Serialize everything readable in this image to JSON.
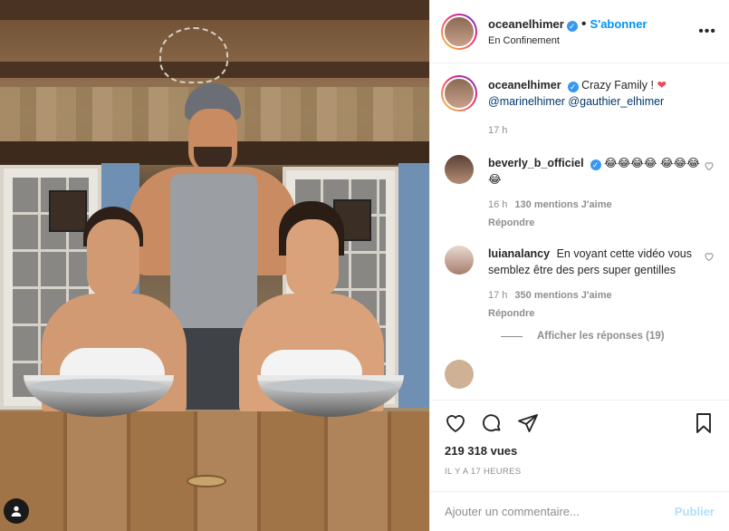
{
  "post": {
    "username": "oceanelhimer",
    "location": "En Confinement",
    "follow_label": "S'abonner",
    "dot": "•",
    "more_icon": "more-horizontal-icon",
    "caption_text": "Crazy Family !",
    "caption_emoji": "❤",
    "caption_mentions": [
      "@marinelhimer",
      "@gauthier_elhimer"
    ],
    "caption_time": "17 h",
    "views": "219 318 vues",
    "posted_ago": "IL Y A 17 HEURES"
  },
  "comments": [
    {
      "username": "beverly_b_officiel",
      "verified": true,
      "text": "😂😂😂😂 😂😂😂😂",
      "time": "16 h",
      "likes": "130 mentions J'aime",
      "reply_label": "Répondre"
    },
    {
      "username": "luianalancy",
      "verified": false,
      "text": "En voyant cette vidéo vous semblez être des pers super gentilles",
      "time": "17 h",
      "likes": "350 mentions J'aime",
      "reply_label": "Répondre",
      "show_replies": "Afficher les réponses (19)"
    }
  ],
  "composer": {
    "placeholder": "Ajouter un commentaire...",
    "post_label": "Publier"
  },
  "colors": {
    "accent": "#0095f6",
    "verified": "#3897f0",
    "heart": "#ed4956",
    "muted": "#8e8e8e"
  }
}
